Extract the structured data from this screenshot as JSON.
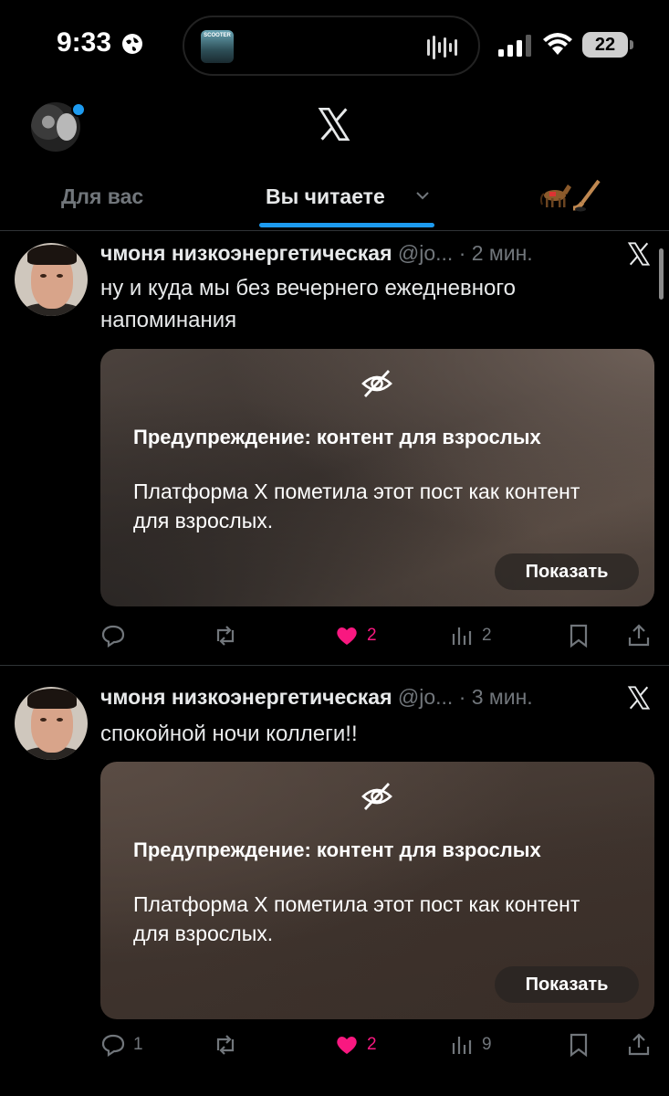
{
  "status_bar": {
    "time": "9:33",
    "album_text": "SCOOTER",
    "battery": "22",
    "icons": [
      "globe-icon",
      "waveform-icon",
      "signal-icon",
      "wifi-icon",
      "battery-icon"
    ]
  },
  "header": {
    "logo": "x-logo-icon",
    "tabs": [
      {
        "label": "Для вас",
        "active": false
      },
      {
        "label": "Вы читаете",
        "active": true
      }
    ],
    "accent": "#1d9bf0"
  },
  "tweets": [
    {
      "name": "чмоня низкоэнергетическая",
      "handle": "@jo...",
      "time": "· 2 мин.",
      "text": "ну и куда мы без вечернего ежедневного напоминания",
      "warning_title": "Предупреждение: контент для взрослых",
      "warning_body": "Платформа X пометила этот пост как контент для взрослых.",
      "show_label": "Показать",
      "replies": "",
      "likes": "2",
      "views": "2"
    },
    {
      "name": "чмоня низкоэнергетическая",
      "handle": "@jo...",
      "time": "· 3 мин.",
      "text": "спокойной ночи коллеги!!",
      "warning_title": "Предупреждение: контент для взрослых",
      "warning_body": "Платформа X пометила этот пост как контент для взрослых.",
      "show_label": "Показать",
      "replies": "1",
      "likes": "2",
      "views": "9"
    }
  ],
  "colors": {
    "like": "#f91880",
    "muted": "#71767b",
    "text": "#e7e9ea"
  }
}
